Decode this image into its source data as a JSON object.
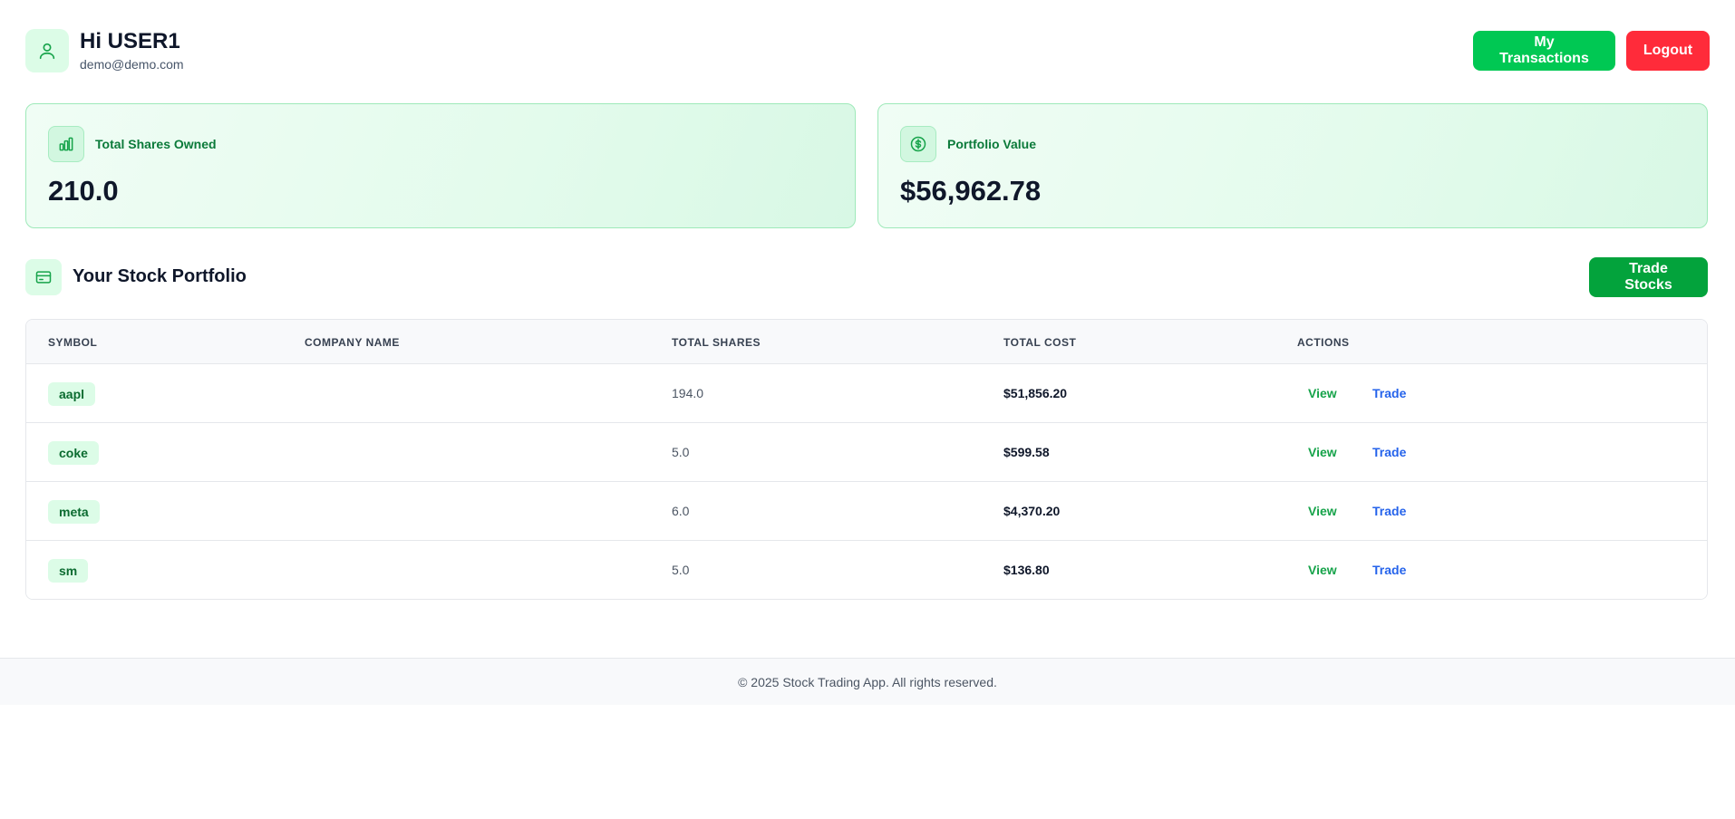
{
  "header": {
    "greeting": "Hi USER1",
    "email": "demo@demo.com",
    "transactions_label": "My Transactions",
    "logout_label": "Logout",
    "avatar_icon": "user-icon"
  },
  "stats": {
    "shares": {
      "label": "Total Shares Owned",
      "value": "210.0",
      "icon": "bar-chart-icon"
    },
    "value": {
      "label": "Portfolio Value",
      "value": "$56,962.78",
      "icon": "dollar-circle-icon"
    }
  },
  "portfolio": {
    "title": "Your Stock Portfolio",
    "icon": "card-icon",
    "trade_button_label": "Trade Stocks",
    "columns": {
      "symbol": "SYMBOL",
      "company": "COMPANY NAME",
      "shares": "TOTAL SHARES",
      "cost": "TOTAL COST",
      "actions": "ACTIONS"
    },
    "rows": [
      {
        "symbol": "aapl",
        "company": "",
        "shares": "194.0",
        "cost": "$51,856.20",
        "view": "View",
        "trade": "Trade"
      },
      {
        "symbol": "coke",
        "company": "",
        "shares": "5.0",
        "cost": "$599.58",
        "view": "View",
        "trade": "Trade"
      },
      {
        "symbol": "meta",
        "company": "",
        "shares": "6.0",
        "cost": "$4,370.20",
        "view": "View",
        "trade": "Trade"
      },
      {
        "symbol": "sm",
        "company": "",
        "shares": "5.0",
        "cost": "$136.80",
        "view": "View",
        "trade": "Trade"
      }
    ]
  },
  "footer": {
    "text": "© 2025 Stock Trading App. All rights reserved."
  },
  "colors": {
    "primary_green": "#00c853",
    "danger_red": "#ff2b3a",
    "trade_green": "#03a33c",
    "link_blue": "#2563eb"
  }
}
